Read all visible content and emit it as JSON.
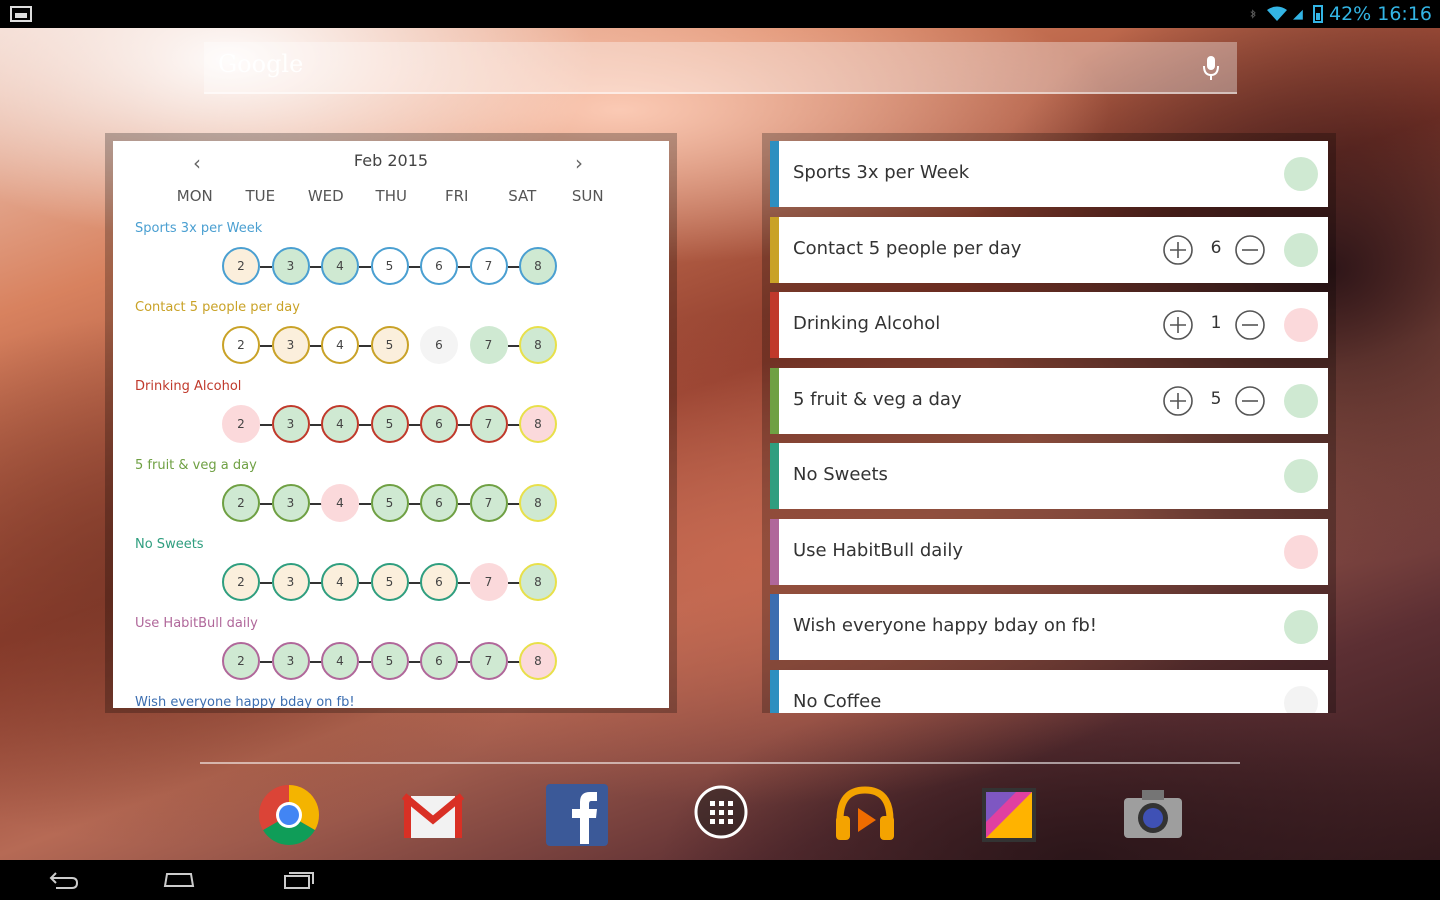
{
  "status_bar": {
    "battery": "42%",
    "time": "16:16"
  },
  "search": {
    "placeholder": "Google"
  },
  "calendar": {
    "month": "Feb 2015",
    "weekdays": [
      "MON",
      "TUE",
      "WED",
      "THU",
      "FRI",
      "SAT",
      "SUN"
    ],
    "habits": [
      {
        "name": "Sports 3x per Week",
        "color": "#4a9fd1",
        "days": [
          {
            "n": "2",
            "state": "partial"
          },
          {
            "n": "3",
            "state": "done"
          },
          {
            "n": "4",
            "state": "done"
          },
          {
            "n": "5",
            "state": "empty"
          },
          {
            "n": "6",
            "state": "empty"
          },
          {
            "n": "7",
            "state": "empty"
          },
          {
            "n": "8",
            "state": "done"
          }
        ]
      },
      {
        "name": "Contact 5 people per day",
        "color": "#c9a227",
        "days": [
          {
            "n": "2",
            "state": "empty"
          },
          {
            "n": "3",
            "state": "partial"
          },
          {
            "n": "4",
            "state": "empty"
          },
          {
            "n": "5",
            "state": "partial"
          },
          {
            "n": "6",
            "state": "none"
          },
          {
            "n": "7",
            "state": "filled"
          },
          {
            "n": "8",
            "state": "today-done"
          }
        ]
      },
      {
        "name": "Drinking Alcohol",
        "color": "#c0392b",
        "days": [
          {
            "n": "2",
            "state": "failed"
          },
          {
            "n": "3",
            "state": "done"
          },
          {
            "n": "4",
            "state": "done"
          },
          {
            "n": "5",
            "state": "done"
          },
          {
            "n": "6",
            "state": "done"
          },
          {
            "n": "7",
            "state": "done"
          },
          {
            "n": "8",
            "state": "today-failed"
          }
        ]
      },
      {
        "name": "5 fruit & veg a day",
        "color": "#6fa043",
        "days": [
          {
            "n": "2",
            "state": "done"
          },
          {
            "n": "3",
            "state": "done"
          },
          {
            "n": "4",
            "state": "failed-plain"
          },
          {
            "n": "5",
            "state": "done"
          },
          {
            "n": "6",
            "state": "done"
          },
          {
            "n": "7",
            "state": "done"
          },
          {
            "n": "8",
            "state": "today-done"
          }
        ]
      },
      {
        "name": "No Sweets",
        "color": "#2f9e7f",
        "days": [
          {
            "n": "2",
            "state": "partial"
          },
          {
            "n": "3",
            "state": "partial"
          },
          {
            "n": "4",
            "state": "partial"
          },
          {
            "n": "5",
            "state": "partial"
          },
          {
            "n": "6",
            "state": "partial"
          },
          {
            "n": "7",
            "state": "failed-plain"
          },
          {
            "n": "8",
            "state": "today-done"
          }
        ]
      },
      {
        "name": "Use HabitBull daily",
        "color": "#b0679a",
        "days": [
          {
            "n": "2",
            "state": "done"
          },
          {
            "n": "3",
            "state": "done"
          },
          {
            "n": "4",
            "state": "done"
          },
          {
            "n": "5",
            "state": "done"
          },
          {
            "n": "6",
            "state": "done"
          },
          {
            "n": "7",
            "state": "done"
          },
          {
            "n": "8",
            "state": "today-failed"
          }
        ]
      },
      {
        "name": "Wish everyone happy bday on fb!",
        "color": "#3b6db0",
        "days": []
      }
    ]
  },
  "habit_list": [
    {
      "name": "Sports 3x per Week",
      "bar": "#2e8fc0",
      "status": "done"
    },
    {
      "name": "Contact 5 people per day",
      "bar": "#c9a227",
      "status": "done",
      "count": "6"
    },
    {
      "name": "Drinking Alcohol",
      "bar": "#c0392b",
      "status": "failed",
      "count": "1"
    },
    {
      "name": "5 fruit & veg a day",
      "bar": "#6fa043",
      "status": "done",
      "count": "5"
    },
    {
      "name": "No Sweets",
      "bar": "#2f9e7f",
      "status": "done"
    },
    {
      "name": "Use HabitBull daily",
      "bar": "#b0679a",
      "status": "failed"
    },
    {
      "name": "Wish everyone happy bday on fb!",
      "bar": "#3b6db0",
      "status": "done"
    },
    {
      "name": "No Coffee",
      "bar": "#2e8fc0",
      "status": "none"
    }
  ],
  "dock": [
    {
      "icon": "chrome-icon"
    },
    {
      "icon": "gmail-icon"
    },
    {
      "icon": "facebook-icon"
    },
    {
      "icon": "app-drawer-icon"
    },
    {
      "icon": "play-music-icon"
    },
    {
      "icon": "gallery-icon"
    },
    {
      "icon": "camera-icon"
    }
  ],
  "colors": {
    "done": "#cfe9d2",
    "failed": "#fbd9db",
    "partial": "#fbefdc",
    "today_ring": "#e8e04a"
  }
}
